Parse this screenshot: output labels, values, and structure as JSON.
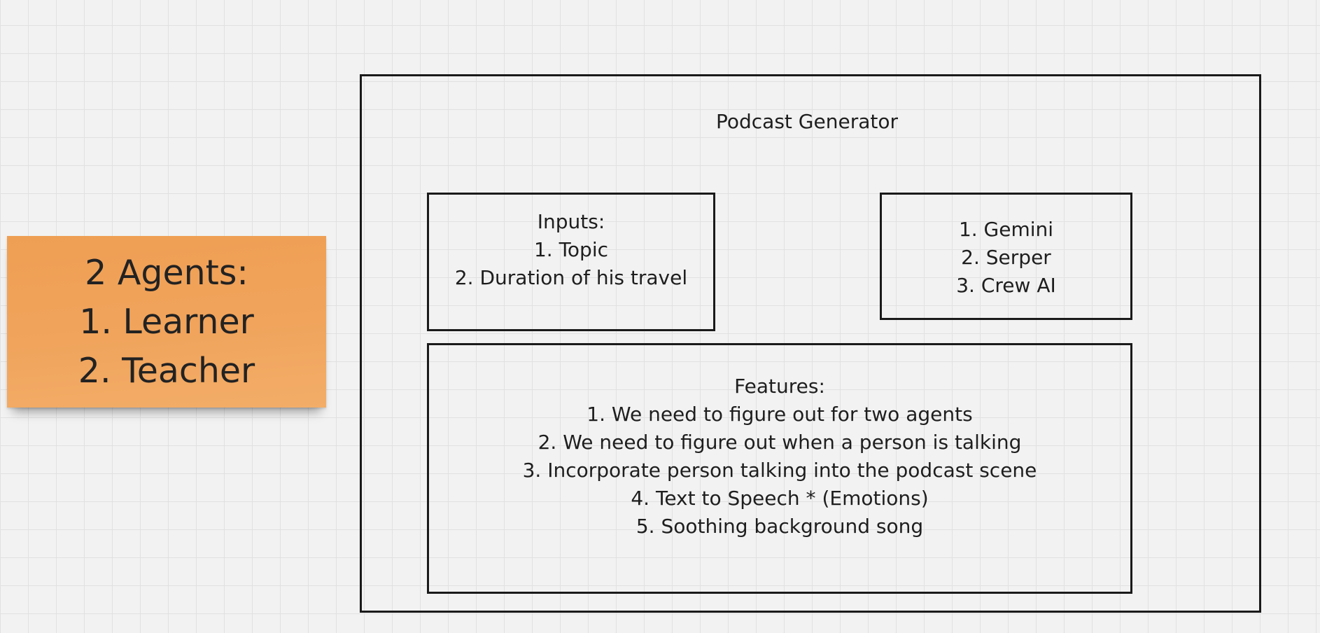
{
  "sticky_note": {
    "color": "#f0a45c",
    "lines": [
      "2 Agents:",
      "1. Learner",
      "2. Teacher"
    ]
  },
  "frame": {
    "title": "Podcast Generator"
  },
  "inputs_box": {
    "lines": [
      "Inputs:",
      "1. Topic",
      "2. Duration of his travel"
    ]
  },
  "tools_box": {
    "lines": [
      "1. Gemini",
      "2. Serper",
      "3. Crew AI"
    ]
  },
  "features_box": {
    "lines": [
      "Features:",
      "1. We need to figure out for two agents",
      "2. We need to figure out when a person is talking",
      "3. Incorporate person talking into the podcast scene",
      "4. Text to Speech * (Emotions)",
      "5. Soothing background song"
    ]
  }
}
